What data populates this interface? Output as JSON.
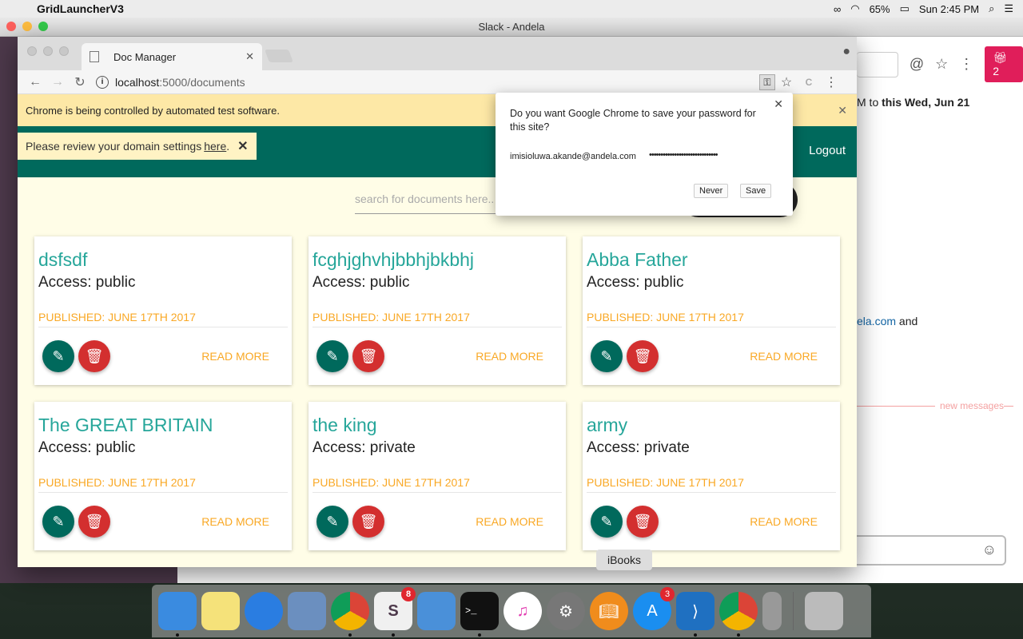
{
  "menubar": {
    "app_name": "GridLauncherV3",
    "battery": "65%",
    "clock": "Sun 2:45 PM"
  },
  "slack": {
    "window_title": "Slack - Andela",
    "gift_count": "2",
    "msg_line1_a": "M to",
    "msg_line1_b": "this Wed, Jun 21",
    "msg_line2_a": "ela.com",
    "msg_line2_b": "and",
    "new_messages": "new messages"
  },
  "chrome": {
    "tab_title": "Doc Manager",
    "url_host": "localhost",
    "url_path": ":5000/documents",
    "infobar_text": "Chrome is being controlled by automated test software."
  },
  "app": {
    "logout": "Logout",
    "domain_note": "Please review your domain settings",
    "domain_link": "here",
    "domain_period": ".",
    "search_placeholder": "search for documents here..",
    "read_more": "READ MORE"
  },
  "documents": [
    {
      "title": "dsfsdf",
      "access": "Access: public",
      "published": "PUBLISHED: JUNE 17TH 2017"
    },
    {
      "title": "fcghjghvhjbbhjbkbhj",
      "access": "Access: public",
      "published": "PUBLISHED: JUNE 17TH 2017"
    },
    {
      "title": "Abba Father",
      "access": "Access: public",
      "published": "PUBLISHED: JUNE 17TH 2017"
    },
    {
      "title": "The GREAT BRITAIN",
      "access": "Access: public",
      "published": "PUBLISHED: JUNE 17TH 2017"
    },
    {
      "title": "the king",
      "access": "Access: private",
      "published": "PUBLISHED: JUNE 17TH 2017"
    },
    {
      "title": "army",
      "access": "Access: private",
      "published": "PUBLISHED: JUNE 17TH 2017"
    }
  ],
  "password_popup": {
    "question": "Do you want Google Chrome to save your password for this site?",
    "username": "imisioluwa.akande@andela.com",
    "password_mask": "••••••••••••••••••••••••••••••",
    "never": "Never",
    "save": "Save"
  },
  "dock": {
    "tooltip": "iBooks",
    "slack_badge": "8",
    "appstore_badge": "3"
  }
}
